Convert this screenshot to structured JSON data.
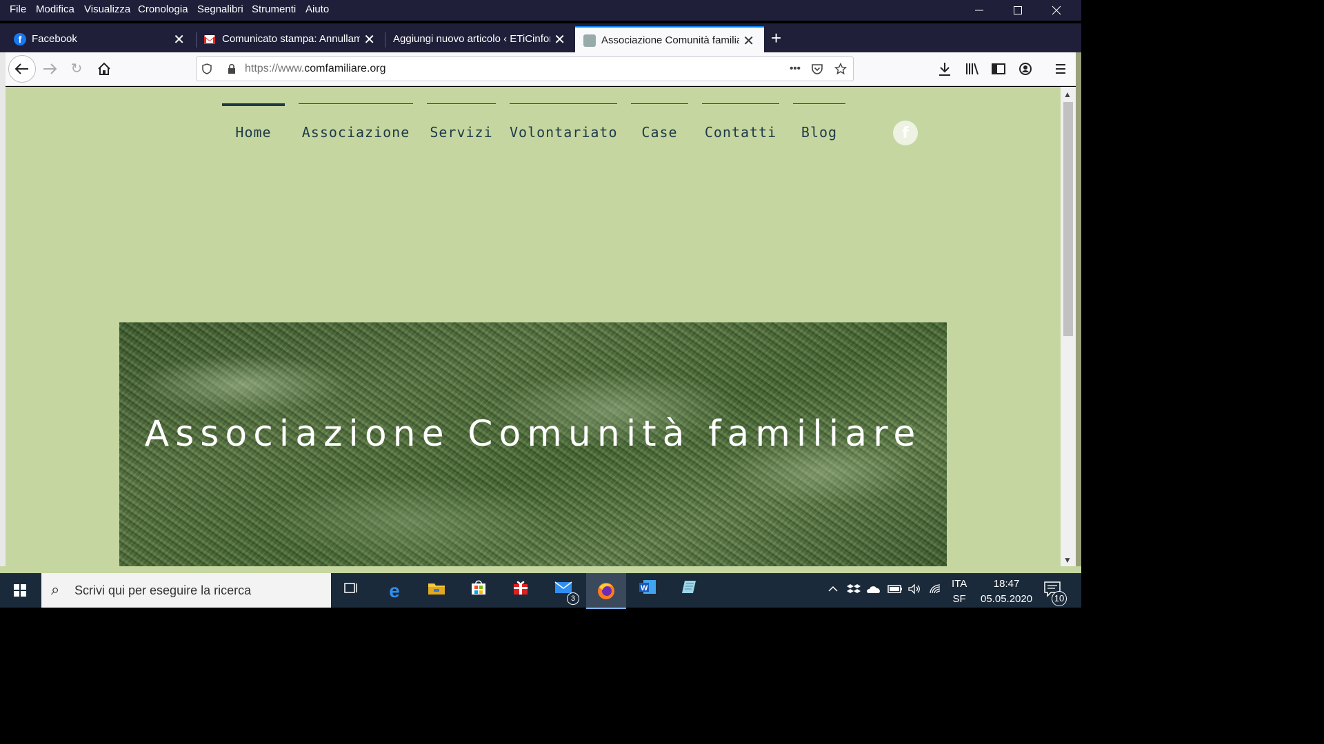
{
  "menubar": {
    "items": [
      "File",
      "Modifica",
      "Visualizza",
      "Cronologia",
      "Segnalibri",
      "Strumenti",
      "Aiuto"
    ]
  },
  "tabs": [
    {
      "label": "Facebook",
      "icon": "facebook-icon",
      "active": false
    },
    {
      "label": "Comunicato stampa: Annullame",
      "icon": "gmail-icon",
      "active": false
    },
    {
      "label": "Aggiungi nuovo articolo ‹ ETiCinfor",
      "icon": "none",
      "active": false
    },
    {
      "label": "Associazione Comunità familiar",
      "icon": "site-icon",
      "active": true
    }
  ],
  "toolbar": {
    "url_prefix": "https://www.",
    "url_domain": "comfamiliare.org",
    "more_label": "•••"
  },
  "site": {
    "nav": [
      "Home",
      "Associazione",
      "Servizi",
      "Volontariato",
      "Case",
      "Contatti",
      "Blog"
    ],
    "current": "Home",
    "facebook_glyph": "f",
    "hero_title": "Associazione Comunità familiare",
    "background_color": "#c5d6a0",
    "text_color": "#1e3a48"
  },
  "taskbar": {
    "search_placeholder": "Scrivi qui per eseguire la ricerca",
    "mail_badge": "3",
    "lang_line1": "ITA",
    "lang_line2": "SF",
    "time": "18:47",
    "date": "05.05.2020",
    "notifications": "10"
  }
}
